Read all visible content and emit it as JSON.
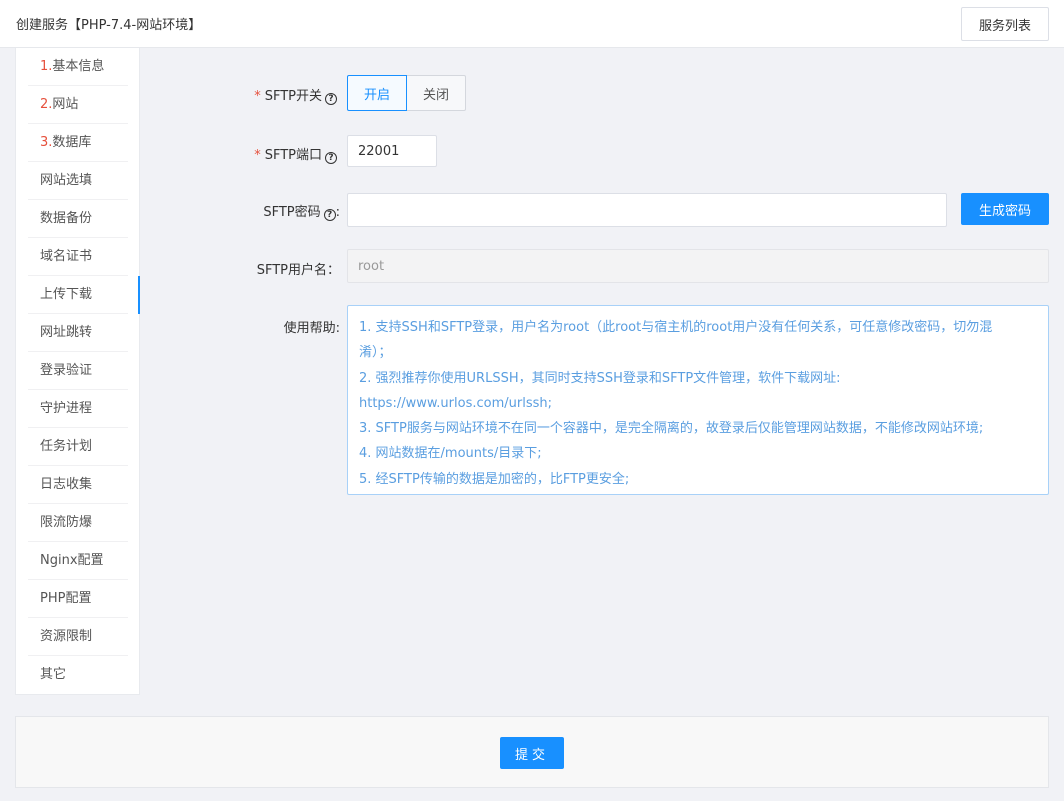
{
  "header": {
    "title": "创建服务【PHP-7.4-网站环境】",
    "list_button": "服务列表"
  },
  "sidebar": {
    "items": [
      {
        "num": "1.",
        "label": "基本信息"
      },
      {
        "num": "2.",
        "label": "网站"
      },
      {
        "num": "3.",
        "label": "数据库"
      },
      {
        "num": "",
        "label": "网站选填"
      },
      {
        "num": "",
        "label": "数据备份"
      },
      {
        "num": "",
        "label": "域名证书"
      },
      {
        "num": "",
        "label": "上传下载"
      },
      {
        "num": "",
        "label": "网址跳转"
      },
      {
        "num": "",
        "label": "登录验证"
      },
      {
        "num": "",
        "label": "守护进程"
      },
      {
        "num": "",
        "label": "任务计划"
      },
      {
        "num": "",
        "label": "日志收集"
      },
      {
        "num": "",
        "label": "限流防爆"
      },
      {
        "num": "",
        "label": "Nginx配置"
      },
      {
        "num": "",
        "label": "PHP配置"
      },
      {
        "num": "",
        "label": "资源限制"
      },
      {
        "num": "",
        "label": "其它"
      }
    ],
    "active_index": 6
  },
  "form": {
    "sftp_switch": {
      "required_mark": "*",
      "label": "SFTP开关",
      "on_label": "开启",
      "off_label": "关闭",
      "selected": "开启"
    },
    "sftp_port": {
      "required_mark": "*",
      "label": "SFTP端口",
      "value": "22001"
    },
    "sftp_password": {
      "label": "SFTP密码",
      "colon": ":",
      "value": "",
      "generate_button": "生成密码"
    },
    "sftp_username": {
      "label": "SFTP用户名：",
      "value": "root"
    },
    "help": {
      "label": "使用帮助:",
      "lines": [
        "1. 支持SSH和SFTP登录，用户名为root（此root与宿主机的root用户没有任何关系，可任意修改密码，切勿混",
        "淆）；",
        "2. 强烈推荐你使用URLSSH，其同时支持SSH登录和SFTP文件管理，软件下载网址:",
        "https://www.urlos.com/urlssh;",
        "3. SFTP服务与网站环境不在同一个容器中，是完全隔离的，故登录后仅能管理网站数据，不能修改网站环境;",
        "4. 网站数据在/mounts/目录下;",
        "5. 经SFTP传输的数据是加密的，比FTP更安全;"
      ]
    }
  },
  "footer": {
    "submit_label": "提交"
  },
  "colors": {
    "primary": "#1890ff",
    "required": "#e6503c",
    "help_text": "#5a9ee0"
  }
}
